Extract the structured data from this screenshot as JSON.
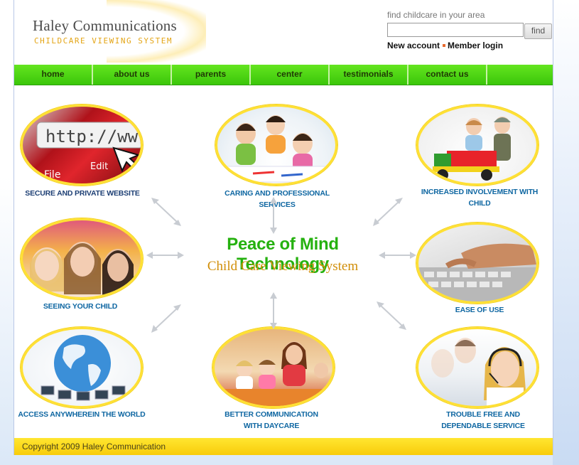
{
  "header": {
    "title": "Haley Communications",
    "subtitle": "CHILDCARE VIEWING SYSTEM",
    "search_label": "find childcare in your area",
    "search_value": "",
    "search_button": "find",
    "new_account": "New account",
    "member_login": "Member login"
  },
  "nav": [
    "home",
    "about us",
    "parents",
    "center",
    "testimonials",
    "contact us"
  ],
  "center": {
    "title": "Peace of Mind Technology",
    "subtitle": "Child Care Viewing System"
  },
  "features": {
    "secure": "SECURE AND PRIVATE WEBSITE",
    "caring": "CARING AND PROFESSIONAL SERVICES",
    "involvement": "INCREASED INVOLVEMENT WITH CHILD",
    "seeing": "SEEING YOUR CHILD",
    "ease": "EASE OF USE",
    "access": "ACCESS ANYWHEREIN THE WORLD",
    "better_1": "BETTER COMMUNICATION",
    "better_2": "WITH DAYCARE",
    "trouble_1": "TROUBLE FREE AND",
    "trouble_2": "DEPENDABLE SERVICE"
  },
  "footer": {
    "copyright": "Copyright 2009 Haley Communication"
  },
  "colors": {
    "nav_green": "#3bc60a",
    "title_green": "#25b10f",
    "subtitle_gold": "#d18e08",
    "frame_yellow": "#ffe033",
    "label_blue": "#1d3f74"
  }
}
